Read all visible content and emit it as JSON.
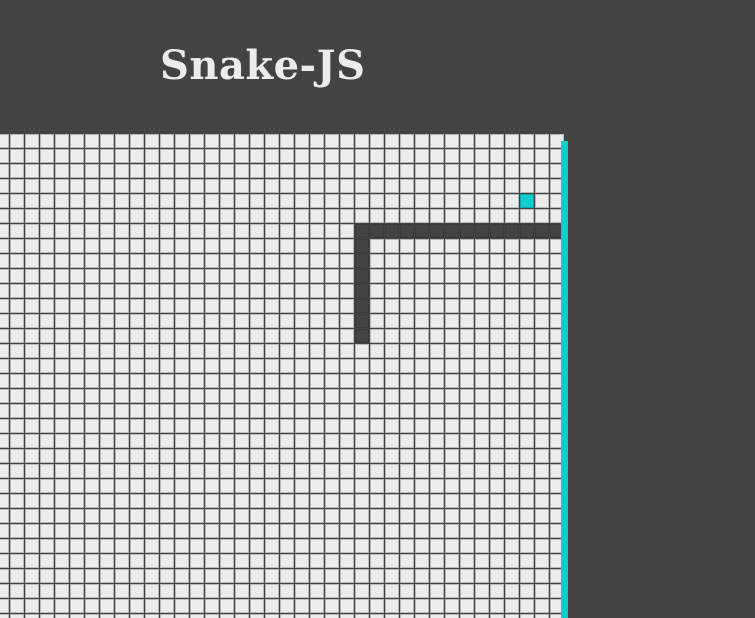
{
  "game": {
    "title": "Snake-JS",
    "colors": {
      "background": "#434343",
      "cell": "#ececec",
      "grid_line": "#b9b9b9",
      "snake": "#434343",
      "food": "#12cece",
      "border_accent": "#0fcbcb"
    },
    "grid": {
      "columns": 38,
      "rows": 33
    },
    "snake": [
      [
        24,
        6
      ],
      [
        25,
        6
      ],
      [
        26,
        6
      ],
      [
        27,
        6
      ],
      [
        28,
        6
      ],
      [
        29,
        6
      ],
      [
        30,
        6
      ],
      [
        31,
        6
      ],
      [
        32,
        6
      ],
      [
        33,
        6
      ],
      [
        34,
        6
      ],
      [
        35,
        6
      ],
      [
        36,
        6
      ],
      [
        37,
        6
      ],
      [
        24,
        7
      ],
      [
        24,
        8
      ],
      [
        24,
        9
      ],
      [
        24,
        10
      ],
      [
        24,
        11
      ],
      [
        24,
        12
      ],
      [
        24,
        13
      ]
    ],
    "food": [
      35,
      4
    ]
  }
}
